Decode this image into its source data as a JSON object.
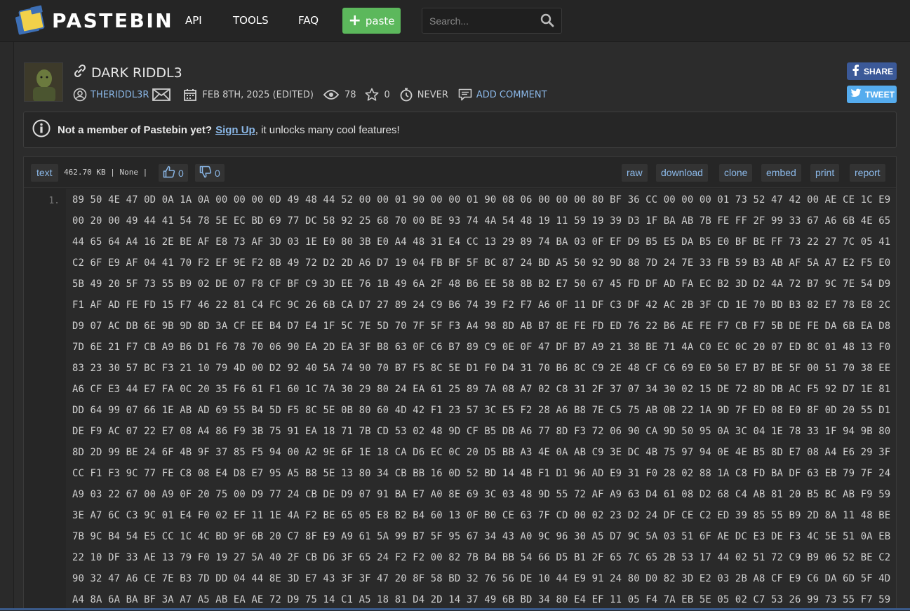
{
  "header": {
    "brand": "PASTEBIN",
    "nav": [
      "API",
      "TOOLS",
      "FAQ"
    ],
    "new_paste_label": "paste",
    "search_placeholder": "Search..."
  },
  "paste": {
    "title": "DARK RIDDL3",
    "author": "THERIDDL3R",
    "date": "FEB 8TH, 2025 (EDITED)",
    "views": "78",
    "rating": "0",
    "expiry": "NEVER",
    "add_comment": "ADD COMMENT"
  },
  "social": {
    "share": "SHARE",
    "tweet": "TWEET",
    "facebook_color": "#3b5998",
    "twitter_color": "#55acee"
  },
  "notice": {
    "lead": "Not a member of Pastebin yet?",
    "signup": "Sign Up",
    "rest": ", it unlocks many cool features!"
  },
  "code": {
    "syntax": "text",
    "size": "462.70 KB",
    "category": "None",
    "likes": "0",
    "dislikes": "0",
    "actions": [
      "raw",
      "download",
      "clone",
      "embed",
      "print",
      "report"
    ],
    "line_number": "1.",
    "rows": [
      "89 50 4E 47 0D 0A 1A 0A 00 00 00 0D 49 48 44 52 00 00 01 90 00 00 01 90 08 06 00 00 00 80 BF 36 CC 00 00 00 01 73 52 47 42 00 AE CE 1C E9 00",
      "00 20 00 49 44 41 54 78 5E EC BD 69 77 DC 58 92 25 68 70 00 BE 93 74 4A 54 48 19 11 59 19 39 D3 1F BA AB 7B FE FF 2F 99 33 67 A6 6B 4E 65 CD",
      "44 65 64 A4 16 2E BE AF E8 73 AF 3D 03 1E E0 80 3B E0 A4 48 31 E4 CC 13 29 89 74 BA 03 0F EF D9 B5 E5 DA B5 E0 BF BE FF 73 22 27 7C 05 41 78",
      "C2 6F E9 AF 04 41 70 F2 EF 9E F2 8B 49 72 D2 2D A6 D7 19 04 FB BF 5F BC 87 24 BD A5 50 92 9D 88 7D 24 7E 33 FB 59 B3 AB AF 5A A7 E2 F5 E0 A3",
      "5B 49 20 5F 73 55 B9 02 DE 07 F8 CF BF C9 3D EE 76 1B 49 6A 2F 48 B6 EE 58 8B B2 E7 50 67 45 FD DF AD FA EC B2 3D D2 4A 72 B7 9C 7E 54 D9 73",
      "F1 AF AD FE FD 15 F7 46 22 81 C4 FC 9C 26 6B CA D7 27 89 24 C9 B6 74 39 F2 F7 A6 0F 11 DF C3 DF 42 AC 2B 3F CD 1E 70 BD B3 82 E7 78 E8 2C 97",
      "D9 07 AC DB 6E 9B 9D 8D 3A CF EE B4 D7 E4 1F 5C 7E 5D 70 7F 5F F3 A4 98 8D AB B7 8E FE FD ED 76 22 B6 AE FE F7 CB F7 5B DE FE DA 6B EA D8 2A",
      "7D 6E 21 F7 CB A9 B6 D1 F6 78 70 06 90 EA 2D EA 3F B8 63 0F C6 B7 89 C9 0E 0F 47 DF B7 A9 21 38 BE 71 4A C0 EC 0C 20 07 ED 8C 01 48 13 F0 C0",
      "83 23 30 57 BC F3 21 10 79 4D 00 D2 92 40 5A 74 90 70 B7 F5 8C 5E D1 F0 D4 31 70 B6 8C C9 2E 48 CF C6 69 E0 50 E7 B7 BE 5F 00 51 70 38 EE F0",
      "A6 CF E3 44 E7 FA 0C 20 35 F6 61 F1 60 1C 7A 30 29 80 24 EA 61 25 89 7A 08 A7 02 C8 31 2F 37 07 34 30 02 15 DE 72 8D DB AC F5 92 D7 1E 81 54",
      "DD 64 99 07 66 1E AB AD 69 55 B4 5D F5 8C 5E 0B 80 60 4D 42 F1 23 57 3C E5 F2 28 A6 B8 7E C5 75 AB 0B 22 1A 9D 7F ED 08 E0 8F 0D 20 55 D1 5D",
      "DE F9 AC 07 22 E7 08 A4 86 F9 3B 75 91 EA 18 71 7B CD 53 02 48 9D CF B5 DB A6 77 8D F3 72 06 90 CA 9D 50 95 0A 3C 04 1E 78 33 1F 94 9B 80 48",
      "8D 2D 99 BE 24 6F 4B 9F 37 85 F5 94 00 A2 9E 6F 1E 18 CA D6 EC 0C 20 D5 BB A3 4E 0A AB C9 3E DC 4B 75 97 94 0E 4E B5 8D E7 08 A4 E6 29 3F 66",
      "CC F1 F3 9C 77 FE C8 08 E4 D8 E7 95 A5 B8 5E 13 80 34 CB BB 16 0D 52 BD 14 4B F1 D1 96 AD E9 31 F0 28 02 88 1A C8 FD BA DF 63 EB 79 7F 24 00",
      "A9 03 22 67 00 A9 0F 20 75 00 D9 77 24 CB DE D9 07 91 BA E7 A0 8E 69 3C 03 48 9D 55 72 AF A9 63 D4 61 08 D2 68 C4 AB 81 20 B5 BC AB F9 59 75",
      "3E A7 6C C3 9C 01 E4 F0 02 EF 11 1E 4A F2 BE 65 05 E8 B2 B4 60 13 0F B0 CE 63 7F CD 00 02 23 D2 24 DF CE C2 ED 39 85 55 B9 2D 8A 11 48 BE 06",
      "7B 9C B4 54 E5 CC 1C 4C BD 9F 6B 20 C7 8F E9 A9 61 5A 99 B7 5F 95 67 34 43 A0 9C 96 30 A5 D7 9C 5A 03 51 6F AE DC E3 DE F3 4C 5E 51 0A EB 25",
      "22 10 DF 33 AE 13 79 F0 19 27 5A 40 2F CB D6 3F 65 24 F2 F2 00 82 7B B4 BB 54 66 D5 B1 2F 65 7C 65 2B 53 17 44 02 51 72 C9 B9 06 52 BE C2 00",
      "90 32 47 A6 CE 7E B3 7D DD 04 44 8E 3D E7 43 3F 3F 47 20 8F 58 BD 32 76 56 DE 10 44 E9 91 24 80 D0 82 3D E2 03 2B A8 CF E9 C6 DA 6D 5F 4D 0D",
      "A4 8A 6A BA BF 3A A7 A5 AB EA AE 72 D9 75 14 C1 A5 18 81 D4 2D 14 37 49 6B BD 34 80 E4 EF 11 05 F4 7A EB 5E 05 02 C7 53 26 99 73 55 F7 59 35"
    ]
  }
}
